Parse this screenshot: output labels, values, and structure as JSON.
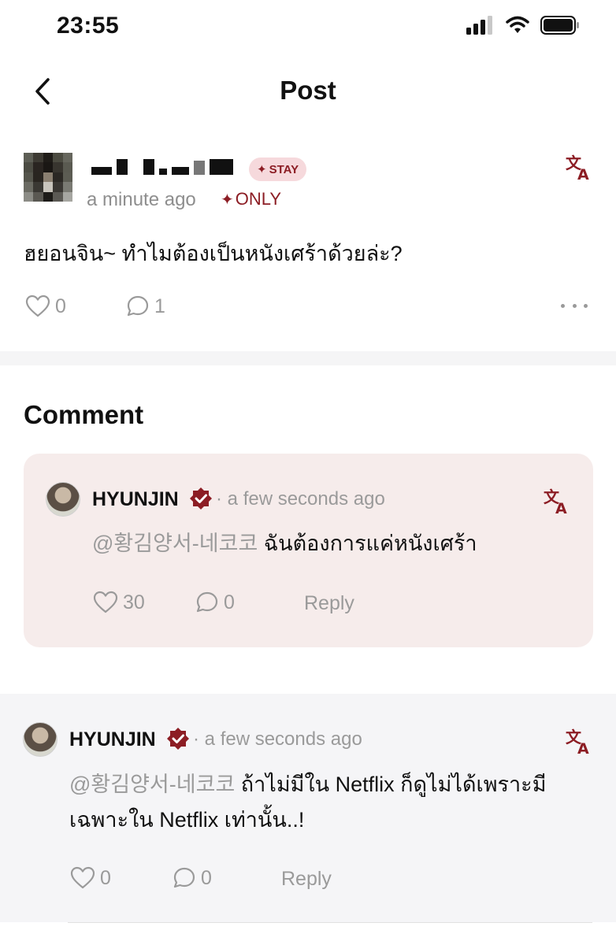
{
  "status_bar": {
    "time": "23:55"
  },
  "nav": {
    "title": "Post"
  },
  "post": {
    "badge": "STAY",
    "time": "a minute ago",
    "only_label": "ONLY",
    "text": "ฮยอนจิน~ ทำไมต้องเป็นหนังเศร้าด้วยล่ะ?",
    "likes": "0",
    "comments": "1"
  },
  "comments_section": {
    "title": "Comment"
  },
  "comments": [
    {
      "author": "HYUNJIN",
      "separator": "·",
      "time": "a few seconds ago",
      "mention": "@황김양서-네코코",
      "text": " ฉันต้องการแค่หนังเศร้า",
      "likes": "30",
      "replies": "0",
      "reply_label": "Reply"
    },
    {
      "author": "HYUNJIN",
      "separator": "·",
      "time": "a few seconds ago",
      "mention": "@황김양서-네코코",
      "text_line1": " ถ้าไม่มีใน Netflix ก็ดูไม่ได้เพราะมี",
      "text_line2": "เฉพาะใน Netflix เท่านั้น..!",
      "likes": "0",
      "replies": "0",
      "reply_label": "Reply"
    }
  ],
  "colors": {
    "accent": "#8c1d24",
    "badge_bg": "#f6d9dc",
    "card_bg": "#f6eceb",
    "muted": "#9a9a9a"
  },
  "icons": [
    "back-icon",
    "signal-icon",
    "wifi-icon",
    "battery-icon",
    "translate-icon",
    "heart-icon",
    "comment-icon",
    "more-icon",
    "verified-icon"
  ]
}
